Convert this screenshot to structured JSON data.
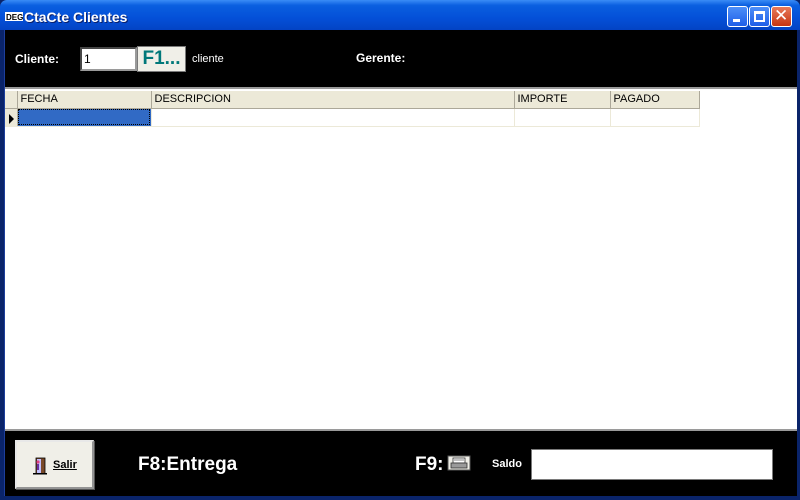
{
  "window": {
    "title": "CtaCte Clientes",
    "icon": "deg-app-icon",
    "controls": [
      "minimize-icon",
      "maximize-icon",
      "close-icon"
    ]
  },
  "header": {
    "cliente_label": "Cliente:",
    "cliente_value": "1",
    "f1_button": "F1...",
    "cliente_name": "cliente",
    "gerente_label": "Gerente:"
  },
  "grid": {
    "columns": [
      "FECHA",
      "DESCRIPCION",
      "IMPORTE",
      "PAGADO"
    ],
    "rows": [
      [
        "",
        "",
        "",
        ""
      ]
    ]
  },
  "footer": {
    "salir_label": "Salir",
    "f8_label": "F8:Entrega",
    "f9_label": "F9:",
    "saldo_label": "Saldo",
    "saldo_value": ""
  },
  "colors": {
    "titlebar": "#0450d8",
    "panel_bg": "#000000",
    "selection": "#316ac5",
    "f1_text": "#00787a"
  }
}
